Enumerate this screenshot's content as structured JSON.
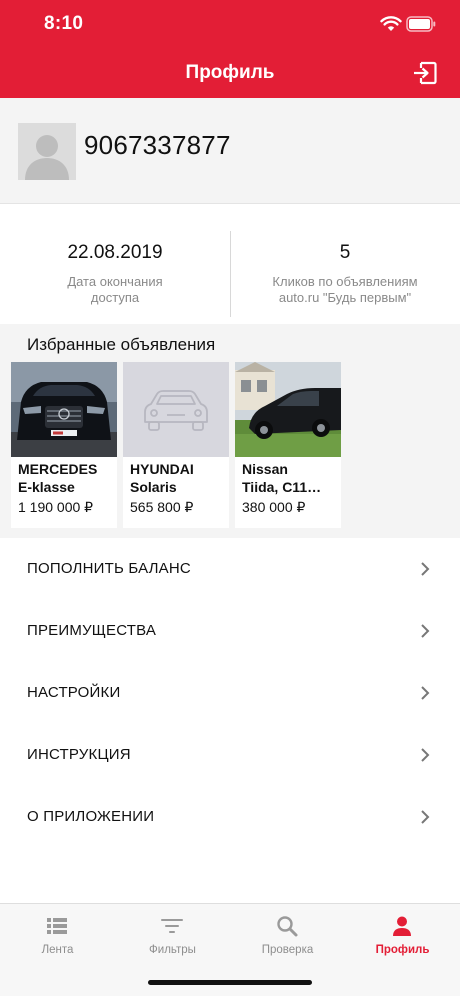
{
  "status_bar": {
    "time": "8:10"
  },
  "navbar": {
    "title": "Профиль",
    "logout_icon": "logout-icon"
  },
  "profile": {
    "phone": "9067337877",
    "avatar_icon": "user-placeholder-icon"
  },
  "stats": [
    {
      "value": "22.08.2019",
      "label_line1": "Дата окончания",
      "label_line2": "доступа"
    },
    {
      "value": "5",
      "label_line1": "Кликов по объявлениям",
      "label_line2": "auto.ru \"Будь первым\""
    }
  ],
  "favorites": {
    "title": "Избранные объявления",
    "items": [
      {
        "name": "MERCEDES\nE-klasse",
        "price": "1 190 000 ₽",
        "image": "mercedes-photo"
      },
      {
        "name": "HYUNDAI\nSolaris",
        "price": "565 800 ₽",
        "image": "car-placeholder-icon"
      },
      {
        "name": "Nissan\nTiida, C11…",
        "price": "380 000 ₽",
        "image": "nissan-photo"
      }
    ]
  },
  "menu": [
    {
      "label": "ПОПОЛНИТЬ БАЛАНС"
    },
    {
      "label": "ПРЕИМУЩЕСТВА"
    },
    {
      "label": "НАСТРОЙКИ"
    },
    {
      "label": "ИНСТРУКЦИЯ"
    },
    {
      "label": "О ПРИЛОЖЕНИИ"
    }
  ],
  "tabs": [
    {
      "label": "Лента",
      "icon": "list-icon",
      "active": false
    },
    {
      "label": "Фильтры",
      "icon": "filter-icon",
      "active": false
    },
    {
      "label": "Проверка",
      "icon": "search-icon",
      "active": false
    },
    {
      "label": "Профиль",
      "icon": "user-icon",
      "active": true
    }
  ],
  "colors": {
    "accent": "#e31e36",
    "inactive": "#8e8e8e",
    "section_bg": "#f4f4f4"
  }
}
